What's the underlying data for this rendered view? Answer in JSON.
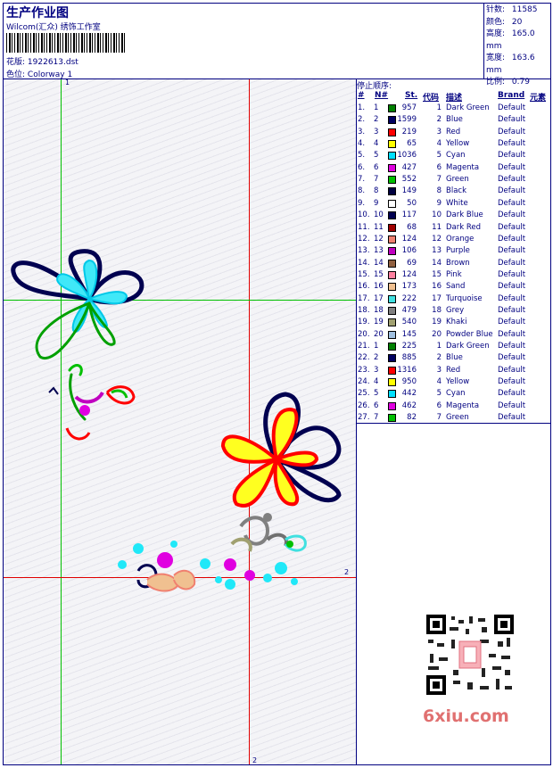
{
  "header": {
    "title": "生产作业图",
    "company": "Wilcom(汇众) 绣饰工作室",
    "design_label": "花版:",
    "design_value": "1922613.dst",
    "colorway_label": "色位:",
    "colorway_value": "Colorway 1"
  },
  "stats": {
    "stitches_label": "针数:",
    "stitches_value": "11585",
    "colors_label": "颜色:",
    "colors_value": "20",
    "height_label": "高度:",
    "height_value": "165.0 mm",
    "width_label": "宽度:",
    "width_value": "163.6 mm",
    "scale_label": "比例:",
    "scale_value": "0.79"
  },
  "canvas": {
    "label_top": "1",
    "label_right": "2",
    "label_bottom": "2"
  },
  "stop_sequence": {
    "title": "停止顺序:",
    "headers": {
      "index": "#",
      "n": "N#",
      "st": "St.",
      "code": "代码",
      "desc": "描述",
      "brand": "Brand",
      "elem": "元素"
    },
    "rows": [
      {
        "index": "1.",
        "n": "1",
        "st": "957",
        "code": "1",
        "desc": "Dark Green",
        "brand": "Default",
        "color": "#008000"
      },
      {
        "index": "2.",
        "n": "2",
        "st": "1599",
        "code": "2",
        "desc": "Blue",
        "brand": "Default",
        "color": "#000060"
      },
      {
        "index": "3.",
        "n": "3",
        "st": "219",
        "code": "3",
        "desc": "Red",
        "brand": "Default",
        "color": "#ff0000"
      },
      {
        "index": "4.",
        "n": "4",
        "st": "65",
        "code": "4",
        "desc": "Yellow",
        "brand": "Default",
        "color": "#ffff00"
      },
      {
        "index": "5.",
        "n": "5",
        "st": "1036",
        "code": "5",
        "desc": "Cyan",
        "brand": "Default",
        "color": "#00e0ff"
      },
      {
        "index": "6.",
        "n": "6",
        "st": "427",
        "code": "6",
        "desc": "Magenta",
        "brand": "Default",
        "color": "#e000e0"
      },
      {
        "index": "7.",
        "n": "7",
        "st": "552",
        "code": "7",
        "desc": "Green",
        "brand": "Default",
        "color": "#00c000"
      },
      {
        "index": "8.",
        "n": "8",
        "st": "149",
        "code": "8",
        "desc": "Black",
        "brand": "Default",
        "color": "#000040"
      },
      {
        "index": "9.",
        "n": "9",
        "st": "50",
        "code": "9",
        "desc": "White",
        "brand": "Default",
        "color": "#ffffff"
      },
      {
        "index": "10.",
        "n": "10",
        "st": "117",
        "code": "10",
        "desc": "Dark Blue",
        "brand": "Default",
        "color": "#000050"
      },
      {
        "index": "11.",
        "n": "11",
        "st": "68",
        "code": "11",
        "desc": "Dark Red",
        "brand": "Default",
        "color": "#a00000"
      },
      {
        "index": "12.",
        "n": "12",
        "st": "124",
        "code": "12",
        "desc": "Orange",
        "brand": "Default",
        "color": "#f08070"
      },
      {
        "index": "13.",
        "n": "13",
        "st": "106",
        "code": "13",
        "desc": "Purple",
        "brand": "Default",
        "color": "#c000c0"
      },
      {
        "index": "14.",
        "n": "14",
        "st": "69",
        "code": "14",
        "desc": "Brown",
        "brand": "Default",
        "color": "#906040"
      },
      {
        "index": "15.",
        "n": "15",
        "st": "124",
        "code": "15",
        "desc": "Pink",
        "brand": "Default",
        "color": "#ff80a0"
      },
      {
        "index": "16.",
        "n": "16",
        "st": "173",
        "code": "16",
        "desc": "Sand",
        "brand": "Default",
        "color": "#f0c090"
      },
      {
        "index": "17.",
        "n": "17",
        "st": "222",
        "code": "17",
        "desc": "Turquoise",
        "brand": "Default",
        "color": "#40e0e0"
      },
      {
        "index": "18.",
        "n": "18",
        "st": "479",
        "code": "18",
        "desc": "Grey",
        "brand": "Default",
        "color": "#808080"
      },
      {
        "index": "19.",
        "n": "19",
        "st": "540",
        "code": "19",
        "desc": "Khaki",
        "brand": "Default",
        "color": "#a0a070"
      },
      {
        "index": "20.",
        "n": "20",
        "st": "145",
        "code": "20",
        "desc": "Powder Blue",
        "brand": "Default",
        "color": "#a0c0e0"
      },
      {
        "index": "21.",
        "n": "1",
        "st": "225",
        "code": "1",
        "desc": "Dark Green",
        "brand": "Default",
        "color": "#008000"
      },
      {
        "index": "22.",
        "n": "2",
        "st": "885",
        "code": "2",
        "desc": "Blue",
        "brand": "Default",
        "color": "#000060"
      },
      {
        "index": "23.",
        "n": "3",
        "st": "1316",
        "code": "3",
        "desc": "Red",
        "brand": "Default",
        "color": "#ff0000"
      },
      {
        "index": "24.",
        "n": "4",
        "st": "950",
        "code": "4",
        "desc": "Yellow",
        "brand": "Default",
        "color": "#ffff00"
      },
      {
        "index": "25.",
        "n": "5",
        "st": "442",
        "code": "5",
        "desc": "Cyan",
        "brand": "Default",
        "color": "#00e0ff"
      },
      {
        "index": "26.",
        "n": "6",
        "st": "462",
        "code": "6",
        "desc": "Magenta",
        "brand": "Default",
        "color": "#e000e0"
      },
      {
        "index": "27.",
        "n": "7",
        "st": "82",
        "code": "7",
        "desc": "Green",
        "brand": "Default",
        "color": "#00c000"
      }
    ]
  },
  "watermark": {
    "site": "6xiu.com"
  }
}
